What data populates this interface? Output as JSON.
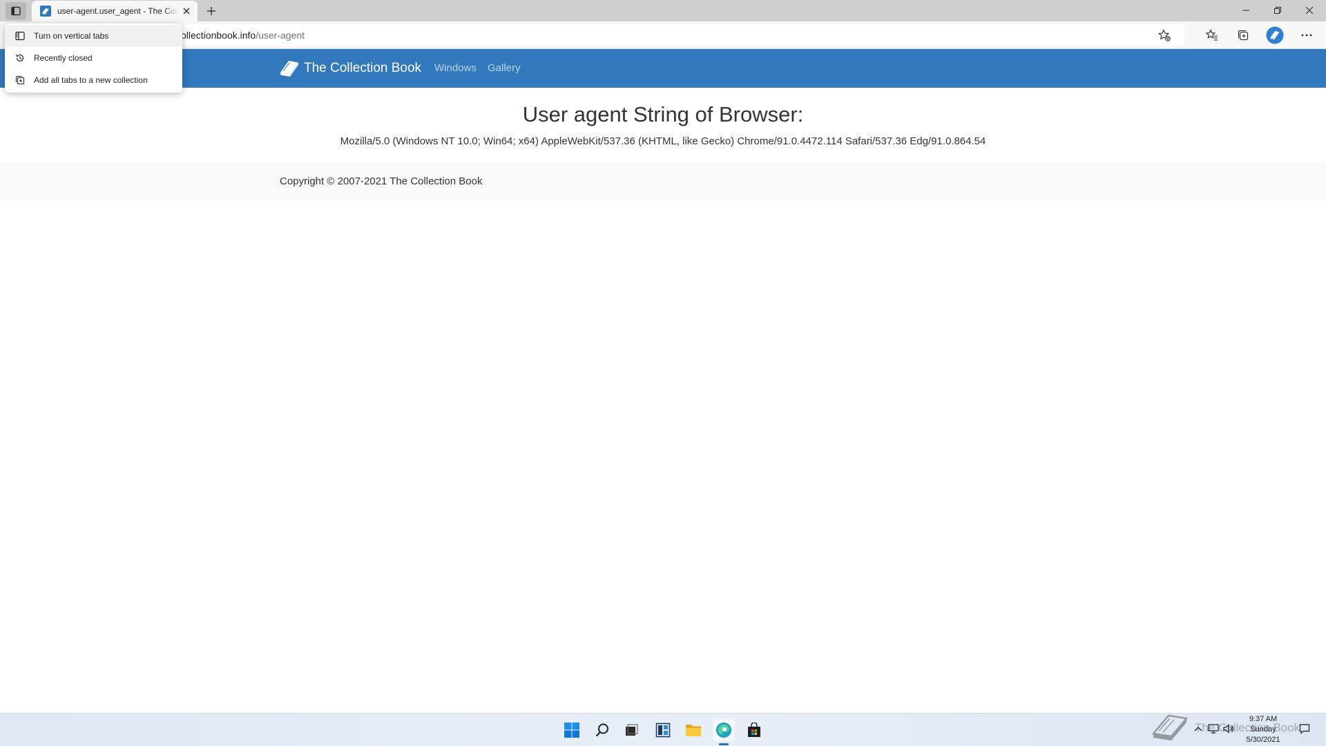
{
  "tab": {
    "title": "user-agent.user_agent - The Collection Book"
  },
  "address_bar": {
    "host": "ollectionbook.info",
    "path": "/user-agent"
  },
  "tab_menu": {
    "items": [
      {
        "label": "Turn on vertical tabs",
        "icon": "vertical-tabs-icon"
      },
      {
        "label": "Recently closed",
        "icon": "history-icon"
      },
      {
        "label": "Add all tabs to a new collection",
        "icon": "collections-icon"
      }
    ]
  },
  "site": {
    "brand": "The Collection Book",
    "nav": [
      "Windows",
      "Gallery"
    ],
    "nav_color": "#3278bd"
  },
  "content": {
    "heading": "User agent String of Browser:",
    "user_agent": "Mozilla/5.0 (Windows NT 10.0; Win64; x64) AppleWebKit/537.36 (KHTML, like Gecko) Chrome/91.0.4472.114 Safari/537.36 Edg/91.0.864.54"
  },
  "footer": {
    "copyright": "Copyright © 2007-2021 The Collection Book"
  },
  "taskbar": {
    "apps": [
      "start-icon",
      "search-icon",
      "task-view-icon",
      "widgets-icon",
      "file-explorer-icon",
      "edge-icon",
      "store-icon"
    ],
    "active_app": "edge-icon"
  },
  "clock": {
    "time": "9:37 AM",
    "day": "Sunday",
    "date": "5/30/2021"
  },
  "watermark": {
    "text": "The Collection Book"
  }
}
